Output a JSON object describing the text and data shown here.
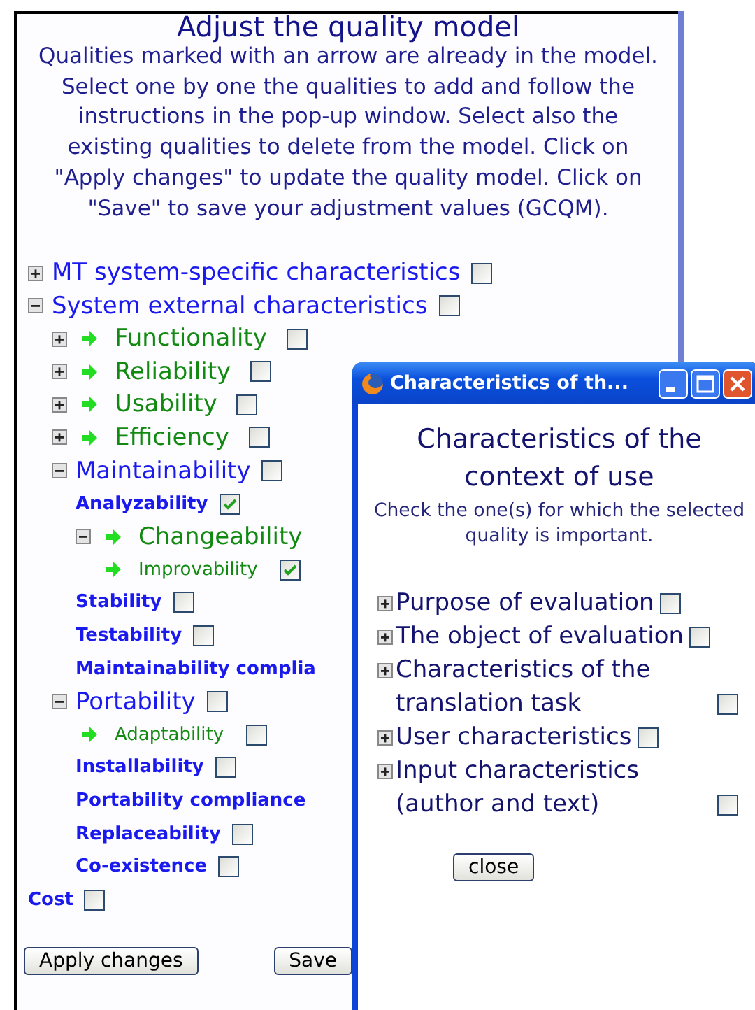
{
  "page": {
    "title": "Adjust the quality model",
    "instructions": "Qualities marked with an arrow are already in the model. Select one by one the qualities to add and follow the instructions in the pop-up window. Select also the existing qualities to delete from the model. Click on \"Apply changes\" to update the quality model. Click on \"Save\" to save your adjustment values (GCQM)."
  },
  "tree": [
    {
      "label": "MT system-specific characteristics",
      "kind": "branch",
      "expanded": false,
      "in_model": false,
      "checked": false
    },
    {
      "label": "System external characteristics",
      "kind": "branch",
      "expanded": true,
      "in_model": false,
      "checked": false,
      "children": [
        {
          "label": "Functionality",
          "kind": "branch",
          "expanded": false,
          "in_model": true,
          "checked": false
        },
        {
          "label": "Reliability",
          "kind": "branch",
          "expanded": false,
          "in_model": true,
          "checked": false
        },
        {
          "label": "Usability",
          "kind": "branch",
          "expanded": false,
          "in_model": true,
          "checked": false
        },
        {
          "label": "Efficiency",
          "kind": "branch",
          "expanded": false,
          "in_model": true,
          "checked": false
        },
        {
          "label": "Maintainability",
          "kind": "branch",
          "expanded": true,
          "in_model": false,
          "checked": false,
          "children": [
            {
              "label": "Analyzability",
              "kind": "leaf",
              "in_model": false,
              "checked": true
            },
            {
              "label": "Changeability",
              "kind": "branch",
              "expanded": true,
              "in_model": true,
              "children": [
                {
                  "label": "Improvability",
                  "kind": "leaf",
                  "in_model": true,
                  "checked": true
                }
              ]
            },
            {
              "label": "Stability",
              "kind": "leaf",
              "in_model": false,
              "checked": false
            },
            {
              "label": "Testability",
              "kind": "leaf",
              "in_model": false,
              "checked": false
            },
            {
              "label": "Maintainability complia",
              "kind": "leaf",
              "in_model": false
            }
          ]
        },
        {
          "label": "Portability",
          "kind": "branch",
          "expanded": true,
          "in_model": false,
          "checked": false,
          "children": [
            {
              "label": "Adaptability",
              "kind": "leaf",
              "in_model": true,
              "checked": false
            },
            {
              "label": "Installability",
              "kind": "leaf",
              "in_model": false,
              "checked": false
            },
            {
              "label": "Portability compliance",
              "kind": "leaf",
              "in_model": false
            },
            {
              "label": "Replaceability",
              "kind": "leaf",
              "in_model": false,
              "checked": false
            },
            {
              "label": "Co-existence",
              "kind": "leaf",
              "in_model": false,
              "checked": false
            }
          ]
        }
      ]
    },
    {
      "label": "Cost",
      "kind": "leaf",
      "in_model": false,
      "checked": false
    }
  ],
  "buttons": [
    {
      "label": "Apply changes"
    },
    {
      "label": "Save"
    }
  ],
  "popup": {
    "window_title": "Characteristics of th...",
    "heading": "Characteristics of the context of use",
    "subtitle": "Check the one(s) for which the selected quality is important.",
    "items": [
      {
        "label": "Purpose of evaluation",
        "expanded": false,
        "checked": false
      },
      {
        "label": "The object of evaluation",
        "expanded": false,
        "checked": false
      },
      {
        "label": "Characteristics of the translation task",
        "expanded": false,
        "checked": false
      },
      {
        "label": "User characteristics",
        "expanded": false,
        "checked": false
      },
      {
        "label": "Input characteristics (author and text)",
        "expanded": false,
        "checked": false
      }
    ],
    "close_button": "close"
  }
}
